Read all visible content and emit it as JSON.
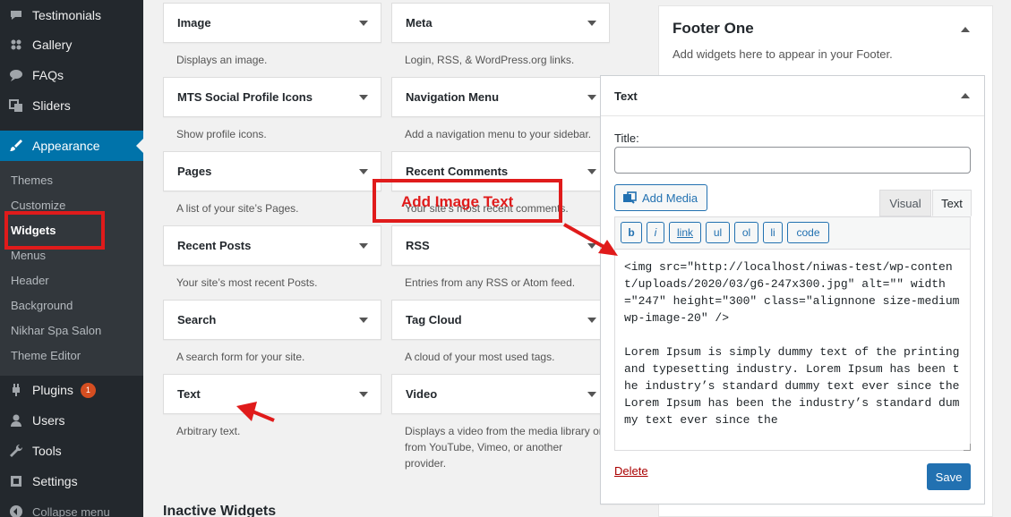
{
  "sidebar": {
    "items": [
      {
        "label": "Testimonials",
        "icon": "testimonial-icon"
      },
      {
        "label": "Gallery",
        "icon": "gallery-icon"
      },
      {
        "label": "FAQs",
        "icon": "faq-icon"
      },
      {
        "label": "Sliders",
        "icon": "sliders-icon"
      },
      {
        "label": "Appearance",
        "icon": "paintbrush-icon",
        "current": true
      },
      {
        "label": "Plugins",
        "icon": "plugin-icon",
        "badge": "1"
      },
      {
        "label": "Users",
        "icon": "users-icon"
      },
      {
        "label": "Tools",
        "icon": "wrench-icon"
      },
      {
        "label": "Settings",
        "icon": "settings-icon"
      }
    ],
    "submenu": [
      "Themes",
      "Customize",
      "Widgets",
      "Menus",
      "Header",
      "Background",
      "Nikhar Spa Salon",
      "Theme Editor"
    ],
    "collapse_label": "Collapse menu"
  },
  "available_widgets": [
    {
      "title": "Image",
      "desc": "Displays an image."
    },
    {
      "title": "Meta",
      "desc": "Login, RSS, & WordPress.org links."
    },
    {
      "title": "MTS Social Profile Icons",
      "desc": "Show profile icons."
    },
    {
      "title": "Navigation Menu",
      "desc": "Add a navigation menu to your sidebar."
    },
    {
      "title": "Pages",
      "desc": "A list of your site’s Pages."
    },
    {
      "title": "Recent Comments",
      "desc": "Your site’s most recent comments."
    },
    {
      "title": "Recent Posts",
      "desc": "Your site’s most recent Posts."
    },
    {
      "title": "RSS",
      "desc": "Entries from any RSS or Atom feed."
    },
    {
      "title": "Search",
      "desc": "A search form for your site."
    },
    {
      "title": "Tag Cloud",
      "desc": "A cloud of your most used tags."
    },
    {
      "title": "Text",
      "desc": "Arbitrary text."
    },
    {
      "title": "Video",
      "desc": "Displays a video from the media library or from YouTube, Vimeo, or another provider."
    }
  ],
  "inactive_title": "Inactive Widgets",
  "footer_area": {
    "title": "Footer One",
    "desc": "Add widgets here to appear in your Footer."
  },
  "text_widget": {
    "header": "Text",
    "title_label": "Title:",
    "title_value": "",
    "add_media_label": "Add Media",
    "tabs": [
      "Visual",
      "Text"
    ],
    "active_tab": "Text",
    "quicktags": [
      "b",
      "i",
      "link",
      "ul",
      "ol",
      "li",
      "code"
    ],
    "content": "<img src=\"http://localhost/niwas-test/wp-content/uploads/2020/03/g6-247x300.jpg\" alt=\"\" width=\"247\" height=\"300\" class=\"alignnone size-medium wp-image-20\" />\n\nLorem Ipsum is simply dummy text of the printing and typesetting industry. Lorem Ipsum has been the industry’s standard dummy text ever since the Lorem Ipsum has been the industry’s standard dummy text ever since the",
    "delete_label": "Delete",
    "save_label": "Save"
  },
  "annotation": {
    "callout_text": "Add Image Text",
    "color": "#e01b1b"
  },
  "colors": {
    "admin_bar": "#23282d",
    "accent": "#0073aa",
    "button_primary": "#2271b1"
  }
}
